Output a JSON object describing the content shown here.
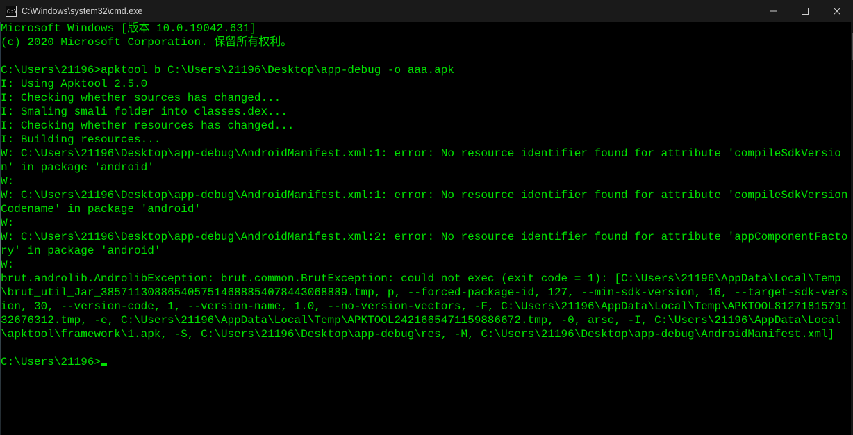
{
  "window": {
    "title": "C:\\Windows\\system32\\cmd.exe"
  },
  "colors": {
    "text": "#00e000",
    "bg": "#000000",
    "titlebar_bg": "#1a1a1a",
    "titlebar_fg": "#d0d0d0"
  },
  "terminal": {
    "prompt1": "C:\\Users\\21196>",
    "command1": "apktool b C:\\Users\\21196\\Desktop\\app-debug -o aaa.apk",
    "prompt2": "C:\\Users\\21196>",
    "lines": [
      "Microsoft Windows [版本 10.0.19042.631]",
      "(c) 2020 Microsoft Corporation. 保留所有权利。",
      "",
      "__PROMPT1__",
      "I: Using Apktool 2.5.0",
      "I: Checking whether sources has changed...",
      "I: Smaling smali folder into classes.dex...",
      "I: Checking whether resources has changed...",
      "I: Building resources...",
      "W: C:\\Users\\21196\\Desktop\\app-debug\\AndroidManifest.xml:1: error: No resource identifier found for attribute 'compileSdkVersion' in package 'android'",
      "W:",
      "W: C:\\Users\\21196\\Desktop\\app-debug\\AndroidManifest.xml:1: error: No resource identifier found for attribute 'compileSdkVersionCodename' in package 'android'",
      "W:",
      "W: C:\\Users\\21196\\Desktop\\app-debug\\AndroidManifest.xml:2: error: No resource identifier found for attribute 'appComponentFactory' in package 'android'",
      "W:",
      "brut.androlib.AndrolibException: brut.common.BrutException: could not exec (exit code = 1): [C:\\Users\\21196\\AppData\\Local\\Temp\\brut_util_Jar_3857113088654057514688854078443068889.tmp, p, --forced-package-id, 127, --min-sdk-version, 16, --target-sdk-version, 30, --version-code, 1, --version-name, 1.0, --no-version-vectors, -F, C:\\Users\\21196\\AppData\\Local\\Temp\\APKTOOL8127181579132676312.tmp, -e, C:\\Users\\21196\\AppData\\Local\\Temp\\APKTOOL2421665471159886672.tmp, -0, arsc, -I, C:\\Users\\21196\\AppData\\Local\\apktool\\framework\\1.apk, -S, C:\\Users\\21196\\Desktop\\app-debug\\res, -M, C:\\Users\\21196\\Desktop\\app-debug\\AndroidManifest.xml]",
      ""
    ]
  }
}
